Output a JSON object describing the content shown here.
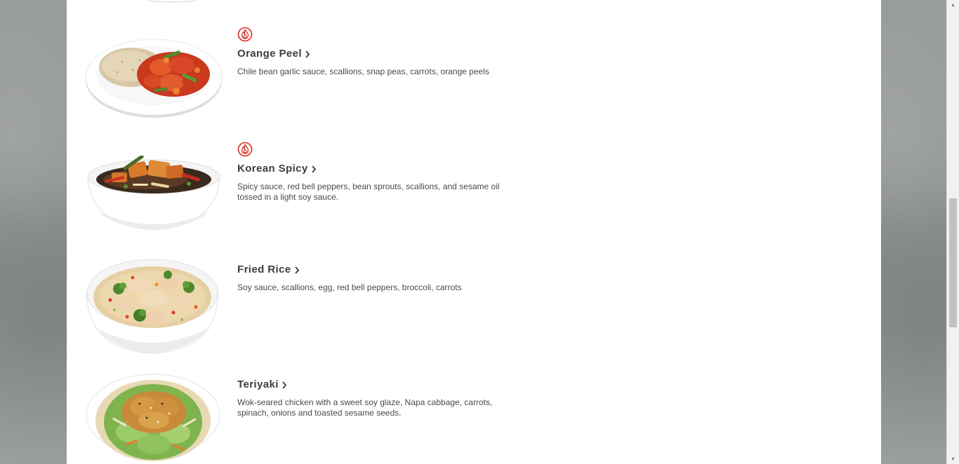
{
  "menu": {
    "items": [
      {
        "name": "Orange Peel",
        "spicy": true,
        "description": "Chile bean garlic sauce, scallions, snap peas, carrots, orange peels",
        "dish": "plate"
      },
      {
        "name": "Korean Spicy",
        "spicy": true,
        "description": "Spicy sauce, red bell peppers, bean sprouts, scallions, and sesame oil tossed in a light soy sauce.",
        "dish": "bowl"
      },
      {
        "name": "Fried Rice",
        "spicy": false,
        "description": "Soy sauce, scallions, egg, red bell peppers, broccoli, carrots",
        "dish": "bowl"
      },
      {
        "name": "Teriyaki",
        "spicy": false,
        "description": "Wok-seared chicken with a sweet soy glaze, Napa cabbage, carrots, spinach, onions and toasted sesame seeds.",
        "dish": "bowl"
      }
    ]
  },
  "icons": {
    "spicy": "flame-icon",
    "more": "chevron-right-icon",
    "scroll_up": "arrow-up-icon",
    "scroll_down": "arrow-down-icon"
  },
  "colors": {
    "spicy_red": "#d52b1e",
    "title_text": "#3c3c3c",
    "body_text": "#4a4a4a"
  }
}
